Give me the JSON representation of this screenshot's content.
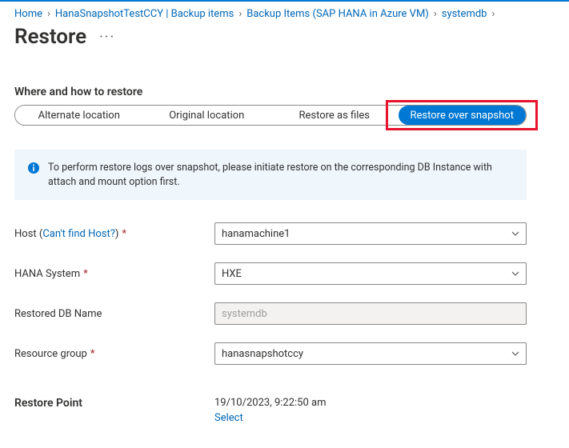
{
  "breadcrumb": {
    "home": "Home",
    "item1": "HanaSnapshotTestCCY | Backup items",
    "item2": "Backup Items (SAP HANA in Azure VM)",
    "item3": "systemdb"
  },
  "title": "Restore",
  "section_where": "Where and how to restore",
  "tabs": {
    "alt": "Alternate location",
    "orig": "Original location",
    "files": "Restore as files",
    "snap": "Restore over snapshot"
  },
  "info_text": "To perform restore logs over snapshot, please initiate restore on the corresponding DB Instance with attach and mount option first.",
  "form": {
    "host_label_pre": "Host (",
    "host_help": "Can't find Host?",
    "host_label_post": ")",
    "host_value": "hanamachine1",
    "hana_label": "HANA System",
    "hana_value": "HXE",
    "db_label": "Restored DB Name",
    "db_placeholder": "systemdb",
    "rg_label": "Resource group",
    "rg_value": "hanasnapshotccy"
  },
  "restore_point": {
    "label": "Restore Point",
    "value": "19/10/2023, 9:22:50 am",
    "select": "Select"
  }
}
